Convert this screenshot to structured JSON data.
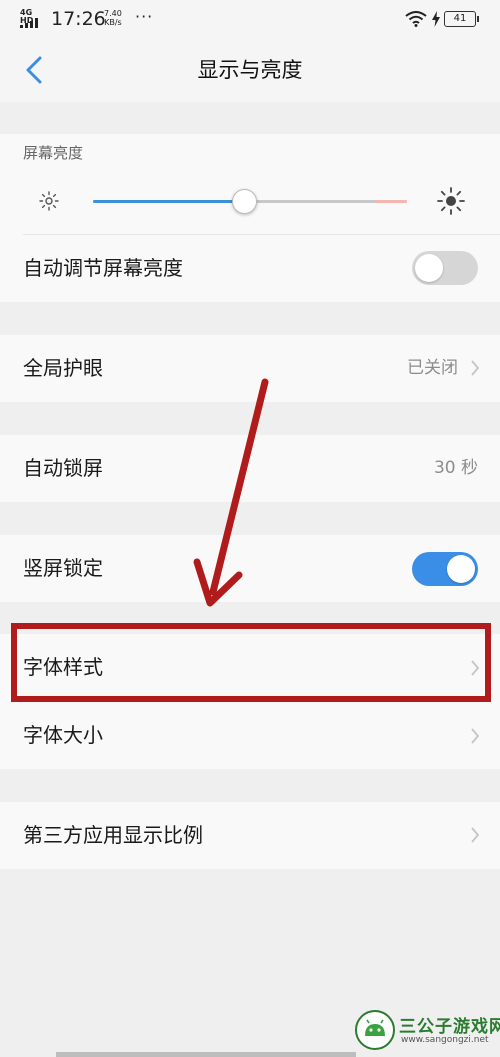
{
  "status_bar": {
    "network": "4G HD",
    "time": "17:26",
    "speed_value": "7.40",
    "speed_unit": "KB/s",
    "more": "···",
    "battery": "41"
  },
  "header": {
    "title": "显示与亮度"
  },
  "brightness": {
    "section_label": "屏幕亮度",
    "level": 0.48,
    "auto_label": "自动调节屏幕亮度",
    "auto_on": false
  },
  "eye_care": {
    "label": "全局护眼",
    "value": "已关闭"
  },
  "auto_lock": {
    "label": "自动锁屏",
    "value": "30 秒"
  },
  "portrait_lock": {
    "label": "竖屏锁定",
    "on": true
  },
  "fonts": {
    "style_label": "字体样式",
    "size_label": "字体大小"
  },
  "display_ratio": {
    "label": "第三方应用显示比例"
  },
  "watermark": {
    "name": "三公子游戏网",
    "url": "www.sangongzi.net"
  },
  "colors": {
    "accent": "#3a8ee6",
    "annotation": "#b01c1c",
    "page_bg": "#efefef",
    "card_bg": "#f9f9f9"
  }
}
